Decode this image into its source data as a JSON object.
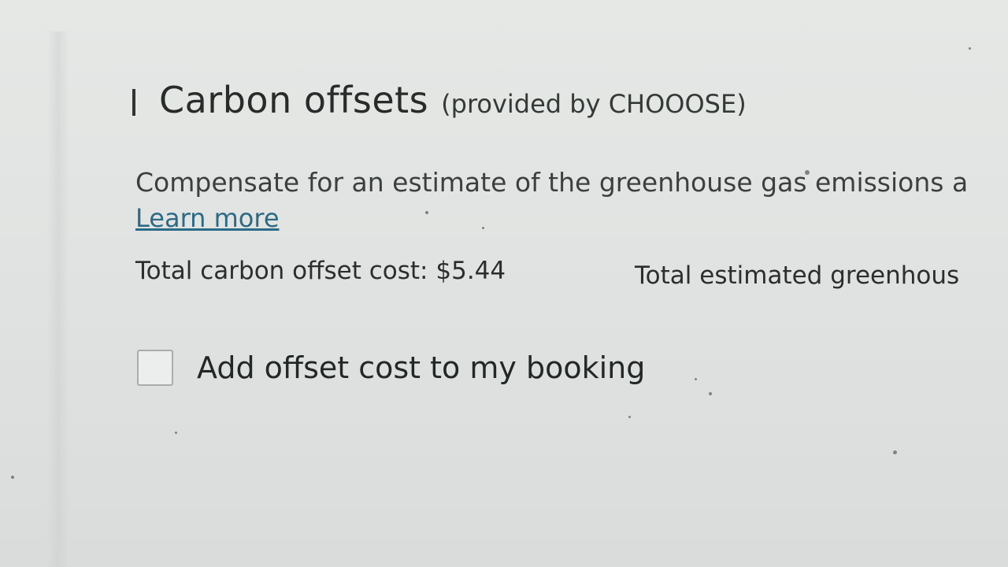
{
  "section": {
    "title": "Carbon offsets",
    "provider": "(provided by CHOOOSE)",
    "description": "Compensate for an estimate of the greenhouse gas emissions a",
    "learn_more": "Learn more",
    "cost_label": "Total carbon offset cost:",
    "cost_value": "$5.44",
    "emissions_label": "Total estimated greenhous",
    "checkbox_label": "Add offset cost to my booking",
    "checkbox_checked": false
  },
  "colors": {
    "background": "#e1e3e2",
    "text": "#2f3533",
    "link": "#2c6b88",
    "checkbox_border": "#a9adab"
  },
  "icons": {
    "heading_marker": "vertical-bar-icon",
    "checkbox": "checkbox-unchecked-icon"
  }
}
